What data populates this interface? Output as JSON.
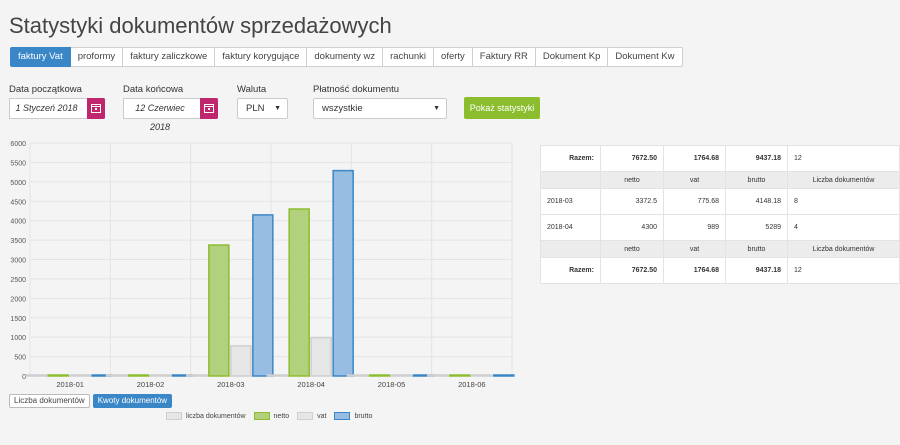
{
  "page": {
    "title": "Statystyki dokumentów sprzedażowych"
  },
  "tabs": [
    "faktury Vat",
    "proformy",
    "faktury zaliczkowe",
    "faktury korygujące",
    "dokumenty wz",
    "rachunki",
    "oferty",
    "Faktury RR",
    "Dokument Kp",
    "Dokument Kw"
  ],
  "active_tab": "faktury Vat",
  "filters": {
    "date_from_label": "Data początkowa",
    "date_from_value": "1 Styczeń 2018",
    "date_to_label": "Data końcowa",
    "date_to_value": "12 Czerwiec 2018",
    "currency_label": "Waluta",
    "currency_value": "PLN",
    "payment_label": "Płatność dokumentu",
    "payment_value": "wszystkie",
    "show_button": "Pokaż statystyki"
  },
  "toggles": {
    "count_label": "Liczba dokumentów",
    "amount_label": "Kwoty dokumentów",
    "active": "amount"
  },
  "colors": {
    "accent": "#3a87c8",
    "show_button": "#8bbd2e",
    "calendar": "#c0266e",
    "count": "#e6e6e6",
    "netto": "#b3d07c",
    "vat": "#e6e6e6",
    "brutto": "#97bde3"
  },
  "chart_data": {
    "type": "bar",
    "categories": [
      "2018-01",
      "2018-02",
      "2018-03",
      "2018-04",
      "2018-05",
      "2018-06"
    ],
    "series": [
      {
        "name": "liczba dokumentów",
        "values": [
          0,
          0,
          0,
          0,
          0,
          0
        ],
        "color": "#e6e6e6"
      },
      {
        "name": "netto",
        "values": [
          0,
          0,
          3372.5,
          4300,
          0,
          0
        ],
        "color": "#b3d07c"
      },
      {
        "name": "vat",
        "values": [
          0,
          0,
          775.68,
          989,
          0,
          0
        ],
        "color": "#e6e6e6"
      },
      {
        "name": "brutto",
        "values": [
          0,
          0,
          4148.18,
          5289,
          0,
          0
        ],
        "color": "#97bde3"
      }
    ],
    "y_ticks": [
      "0",
      "500",
      "1000",
      "1500",
      "2000",
      "2500",
      "3000",
      "3500",
      "4000",
      "4500",
      "5000",
      "5500",
      "6000"
    ],
    "ylim": [
      0,
      6000
    ],
    "grid": true,
    "legend": "bottom"
  },
  "table": {
    "top_total": {
      "label": "Razem:",
      "netto": "7672.50",
      "vat": "1764.68",
      "brutto": "9437.18",
      "count": "12"
    },
    "headers": {
      "netto": "netto",
      "vat": "vat",
      "brutto": "brutto",
      "count": "Liczba dokumentów"
    },
    "rows": [
      {
        "period": "2018-03",
        "netto": "3372.5",
        "vat": "775.68",
        "brutto": "4148.18",
        "count": "8"
      },
      {
        "period": "2018-04",
        "netto": "4300",
        "vat": "989",
        "brutto": "5289",
        "count": "4"
      }
    ],
    "bottom_total": {
      "label": "Razem:",
      "netto": "7672.50",
      "vat": "1764.68",
      "brutto": "9437.18",
      "count": "12"
    }
  }
}
